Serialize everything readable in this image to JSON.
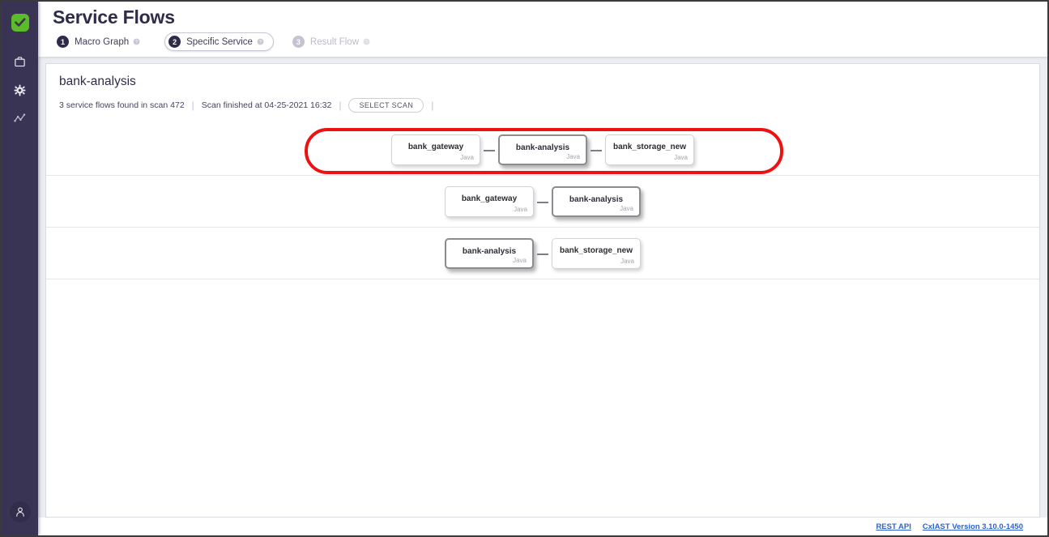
{
  "sidebar": {
    "logo": {
      "icon": "checkmarx-logo-icon",
      "color": "#5bbb28"
    },
    "items": [
      {
        "icon": "briefcase-icon",
        "name": "projects"
      },
      {
        "icon": "gear-icon",
        "name": "settings"
      },
      {
        "icon": "analytics-icon",
        "name": "analytics"
      }
    ],
    "avatar": {
      "icon": "user-icon"
    },
    "background": "#3a3454"
  },
  "header": {
    "title": "Service Flows",
    "steps": [
      {
        "number": "1",
        "label": "Macro Graph",
        "state": "done",
        "help": "help-icon"
      },
      {
        "number": "2",
        "label": "Specific Service",
        "state": "active",
        "help": "help-icon"
      },
      {
        "number": "3",
        "label": "Result Flow",
        "state": "disabled",
        "help": "help-icon"
      }
    ]
  },
  "panel": {
    "service_name": "bank-analysis",
    "meta": {
      "flows_found": "3 service flows found in scan 472",
      "scan_finished": "Scan finished at 04-25-2021 16:32",
      "select_scan_label": "SELECT SCAN",
      "separator": "|"
    },
    "flows": [
      {
        "annotated": true,
        "nodes": [
          {
            "name": "bank_gateway",
            "lang": "Java",
            "highlight": false
          },
          {
            "name": "bank-analysis",
            "lang": "Java",
            "highlight": true
          },
          {
            "name": "bank_storage_new",
            "lang": "Java",
            "highlight": false
          }
        ]
      },
      {
        "annotated": false,
        "nodes": [
          {
            "name": "bank_gateway",
            "lang": "Java",
            "highlight": false
          },
          {
            "name": "bank-analysis",
            "lang": "Java",
            "highlight": true
          }
        ]
      },
      {
        "annotated": false,
        "nodes": [
          {
            "name": "bank-analysis",
            "lang": "Java",
            "highlight": true
          },
          {
            "name": "bank_storage_new",
            "lang": "Java",
            "highlight": false
          }
        ]
      }
    ]
  },
  "footer": {
    "links": [
      {
        "label": "REST API"
      },
      {
        "label": "CxIAST Version 3.10.0-1450"
      }
    ]
  },
  "colors": {
    "accent_green": "#5bbb28",
    "sidebar": "#3a3454",
    "annotation_red": "#ee1111",
    "link_blue": "#2b62d0"
  }
}
